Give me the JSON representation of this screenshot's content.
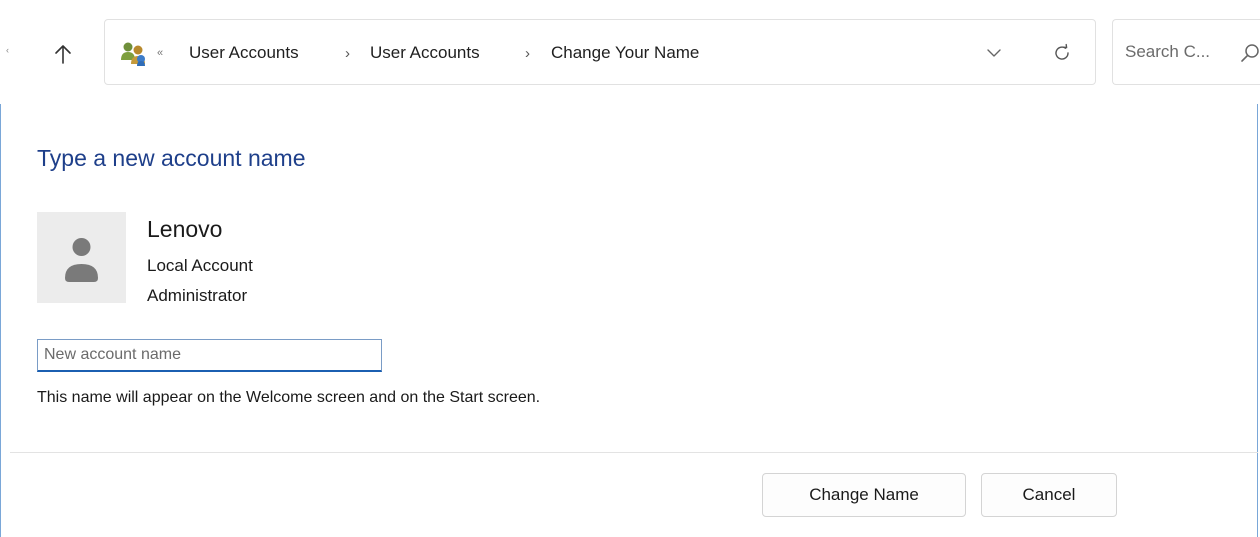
{
  "navigation": {
    "up_icon": "up-arrow-icon",
    "breadcrumb": [
      {
        "label": "User Accounts"
      },
      {
        "label": "User Accounts"
      },
      {
        "label": "Change Your Name"
      }
    ],
    "separator": "›",
    "overflow": "«",
    "dropdown_icon": "chevron-down-icon",
    "refresh_icon": "refresh-icon",
    "location_icon": "user-accounts-icon"
  },
  "search": {
    "placeholder": "Search C...",
    "icon": "search-icon"
  },
  "page": {
    "heading": "Type a new account name"
  },
  "account": {
    "name": "Lenovo",
    "type": "Local Account",
    "role": "Administrator",
    "avatar_icon": "user-avatar-icon"
  },
  "form": {
    "input_placeholder": "New account name",
    "input_value": "",
    "help_text": "This name will appear on the Welcome screen and on the Start screen."
  },
  "actions": {
    "change_label": "Change Name",
    "cancel_label": "Cancel"
  },
  "colors": {
    "heading": "#1e3f8a",
    "focus_border": "#1b5fb1",
    "window_border": "#7aa7d8"
  }
}
